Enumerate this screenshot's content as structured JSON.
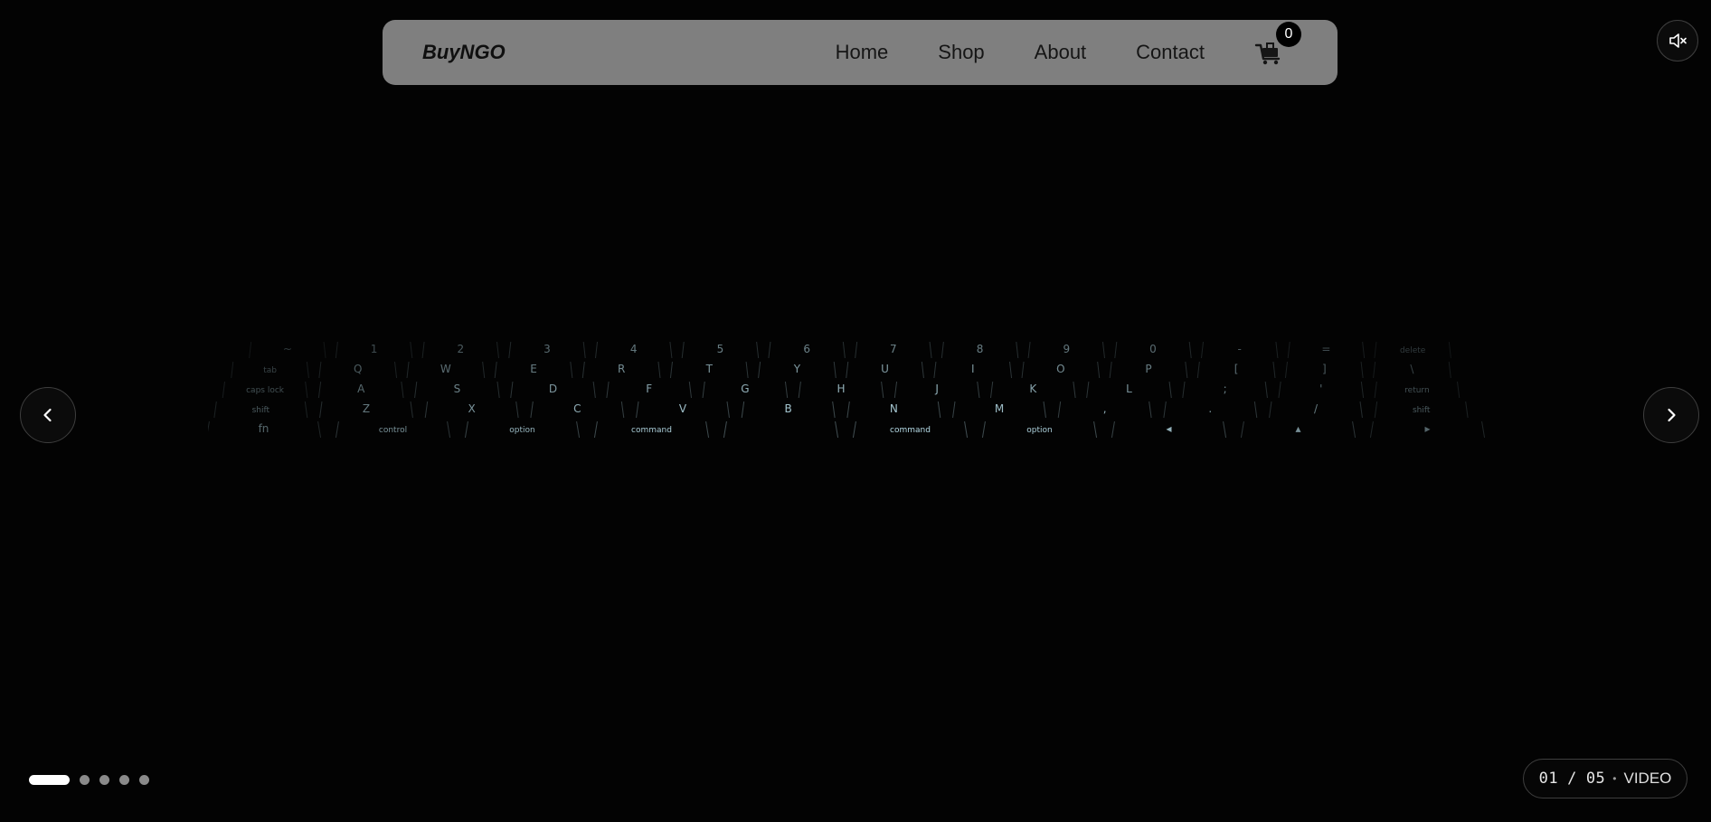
{
  "nav": {
    "logo": "BuyNGO",
    "links": [
      "Home",
      "Shop",
      "About",
      "Contact"
    ],
    "cart_count": "0",
    "cart_icon": "cart-icon"
  },
  "controls": {
    "mute_icon": "speaker-muted-icon",
    "prev_icon": "chevron-left-icon",
    "next_icon": "chevron-right-icon"
  },
  "slider": {
    "current": "01",
    "total": "05",
    "separator": "/",
    "bullet": "•",
    "media_type": "VIDEO",
    "slide_count": 5,
    "active_index": 0
  },
  "hero": {
    "keyboard_rows": [
      [
        "~",
        "1",
        "2",
        "3",
        "4",
        "5",
        "6",
        "7",
        "8",
        "9",
        "0",
        "-",
        "=",
        "delete"
      ],
      [
        "tab",
        "Q",
        "W",
        "E",
        "R",
        "T",
        "Y",
        "U",
        "I",
        "O",
        "P",
        "[",
        "]",
        "\\"
      ],
      [
        "caps lock",
        "A",
        "S",
        "D",
        "F",
        "G",
        "H",
        "J",
        "K",
        "L",
        ";",
        "'",
        "return"
      ],
      [
        "shift",
        "Z",
        "X",
        "C",
        "V",
        "B",
        "N",
        "M",
        ",",
        ".",
        "/",
        "shift"
      ],
      [
        "fn",
        "control",
        "option",
        "command",
        "",
        "command",
        "option",
        "◂",
        "▴",
        "▸"
      ]
    ]
  },
  "colors": {
    "background": "#030303",
    "navbar": "#7f7f7f",
    "dot_active": "#ffffff",
    "dot_inactive": "#8a8a8a",
    "key_glow": "#bfe6f2"
  }
}
